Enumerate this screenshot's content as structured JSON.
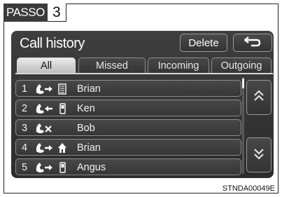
{
  "step": {
    "word": "PASSO",
    "number": "3"
  },
  "screen": {
    "title": "Call history",
    "delete_label": "Delete",
    "back_icon": "back-arrow-icon"
  },
  "tabs": [
    {
      "label": "All",
      "active": true
    },
    {
      "label": "Missed",
      "active": false
    },
    {
      "label": "Incoming",
      "active": false
    },
    {
      "label": "Outgoing",
      "active": false
    }
  ],
  "calls": [
    {
      "index": "1",
      "call_type": "outgoing",
      "device": "home-phone",
      "name": "Brian"
    },
    {
      "index": "2",
      "call_type": "incoming",
      "device": "mobile-phone",
      "name": "Ken"
    },
    {
      "index": "3",
      "call_type": "missed",
      "device": "",
      "name": "Bob"
    },
    {
      "index": "4",
      "call_type": "outgoing",
      "device": "house",
      "name": "Brian"
    },
    {
      "index": "5",
      "call_type": "outgoing",
      "device": "mobile-phone",
      "name": "Angus"
    }
  ],
  "scroll": {
    "up_icon": "double-chevron-up-icon",
    "down_icon": "double-chevron-down-icon"
  },
  "figure_id": "STNDA00049E"
}
